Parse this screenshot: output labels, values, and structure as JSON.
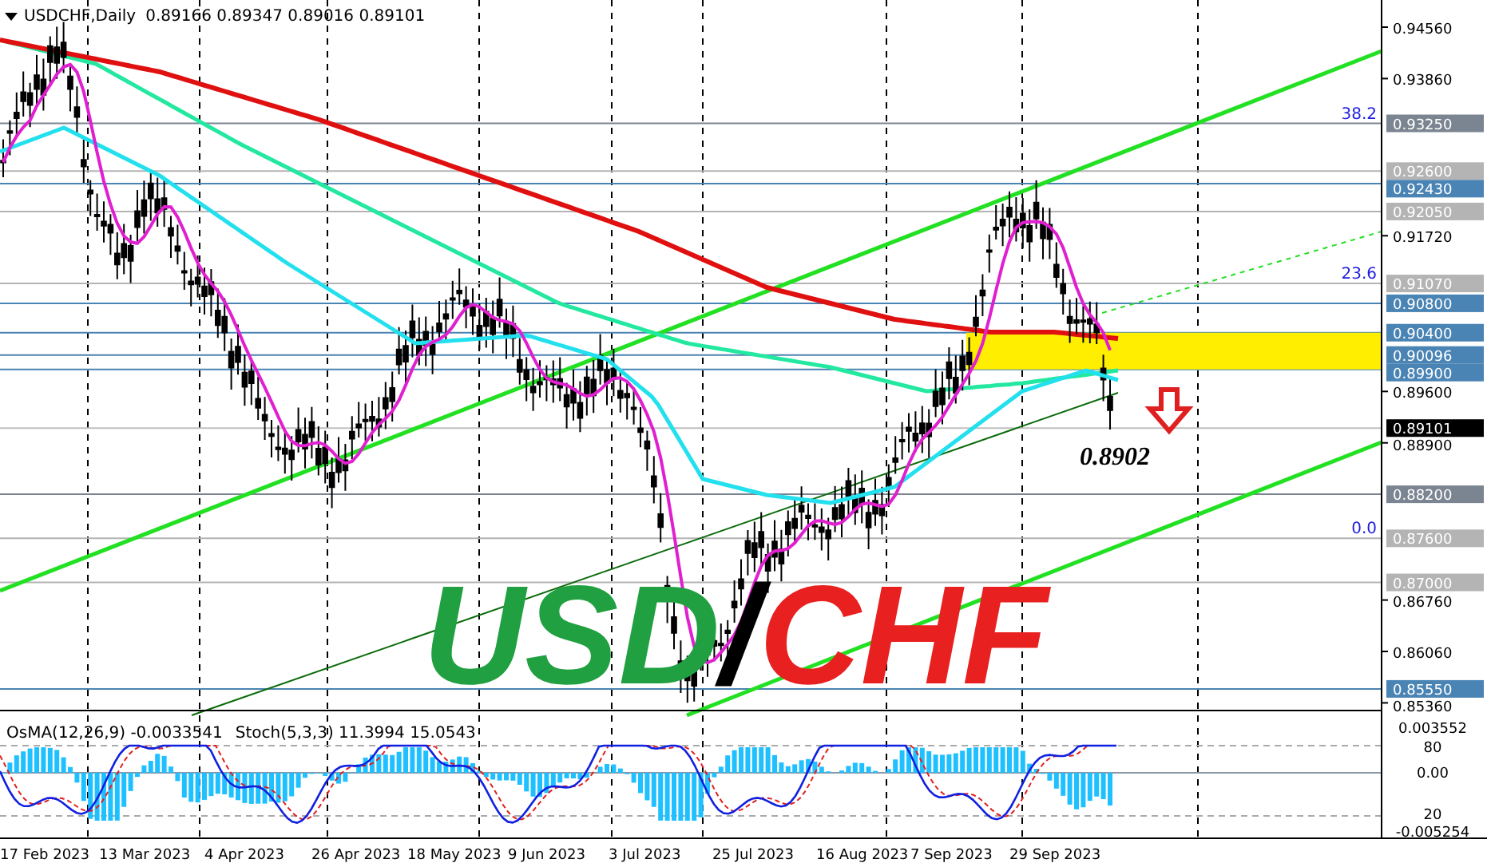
{
  "chart": {
    "symbol": "USDCHF,Daily",
    "ohlc": [
      "0.89166",
      "0.89347",
      "0.89016",
      "0.89101"
    ],
    "price_ticks": [
      "0.94560",
      "0.93860",
      "0.91720",
      "0.89600",
      "0.88900",
      "0.86760",
      "0.86060",
      "0.85360"
    ],
    "levels": [
      {
        "label": "0.93250",
        "color": "#7b8591",
        "fib": "38.2"
      },
      {
        "label": "0.92600",
        "color": "#b4b4b4"
      },
      {
        "label": "0.92430",
        "color": "#4a84b4"
      },
      {
        "label": "0.92050",
        "color": "#b4b4b4"
      },
      {
        "label": "0.91070",
        "color": "#b4b4b4",
        "fib": "23.6"
      },
      {
        "label": "0.90800",
        "color": "#4a84b4"
      },
      {
        "label": "0.90400",
        "color": "#4a84b4"
      },
      {
        "label": "0.90096",
        "color": "#4a84b4"
      },
      {
        "label": "0.89900",
        "color": "#4a84b4"
      },
      {
        "label": "0.89101",
        "color": "#000000"
      },
      {
        "label": "0.88200",
        "color": "#7b8591"
      },
      {
        "label": "0.87600",
        "color": "#b4b4b4",
        "fib": "0.0"
      },
      {
        "label": "0.87000",
        "color": "#b4b4b4"
      },
      {
        "label": "0.85550",
        "color": "#4a84b4"
      }
    ],
    "annotation": "0.8902",
    "overlay_title": {
      "base": "USD",
      "separator": "/",
      "quote": "CHF"
    }
  },
  "indicator": {
    "label": "OsMA(12,26,9) -0.0033541",
    "stoch_label": "Stoch(5,3,3) 11.3994 15.0543",
    "ticks": [
      "0.003552",
      "80",
      "0.00",
      "20",
      "-0.005254"
    ]
  },
  "dates": [
    "17 Feb 2023",
    "13 Mar 2023",
    "4 Apr 2023",
    "26 Apr 2023",
    "18 May 2023",
    "9 Jun 2023",
    "3 Jul 2023",
    "25 Jul 2023",
    "16 Aug 2023",
    "7 Sep 2023",
    "29 Sep 2023"
  ]
}
